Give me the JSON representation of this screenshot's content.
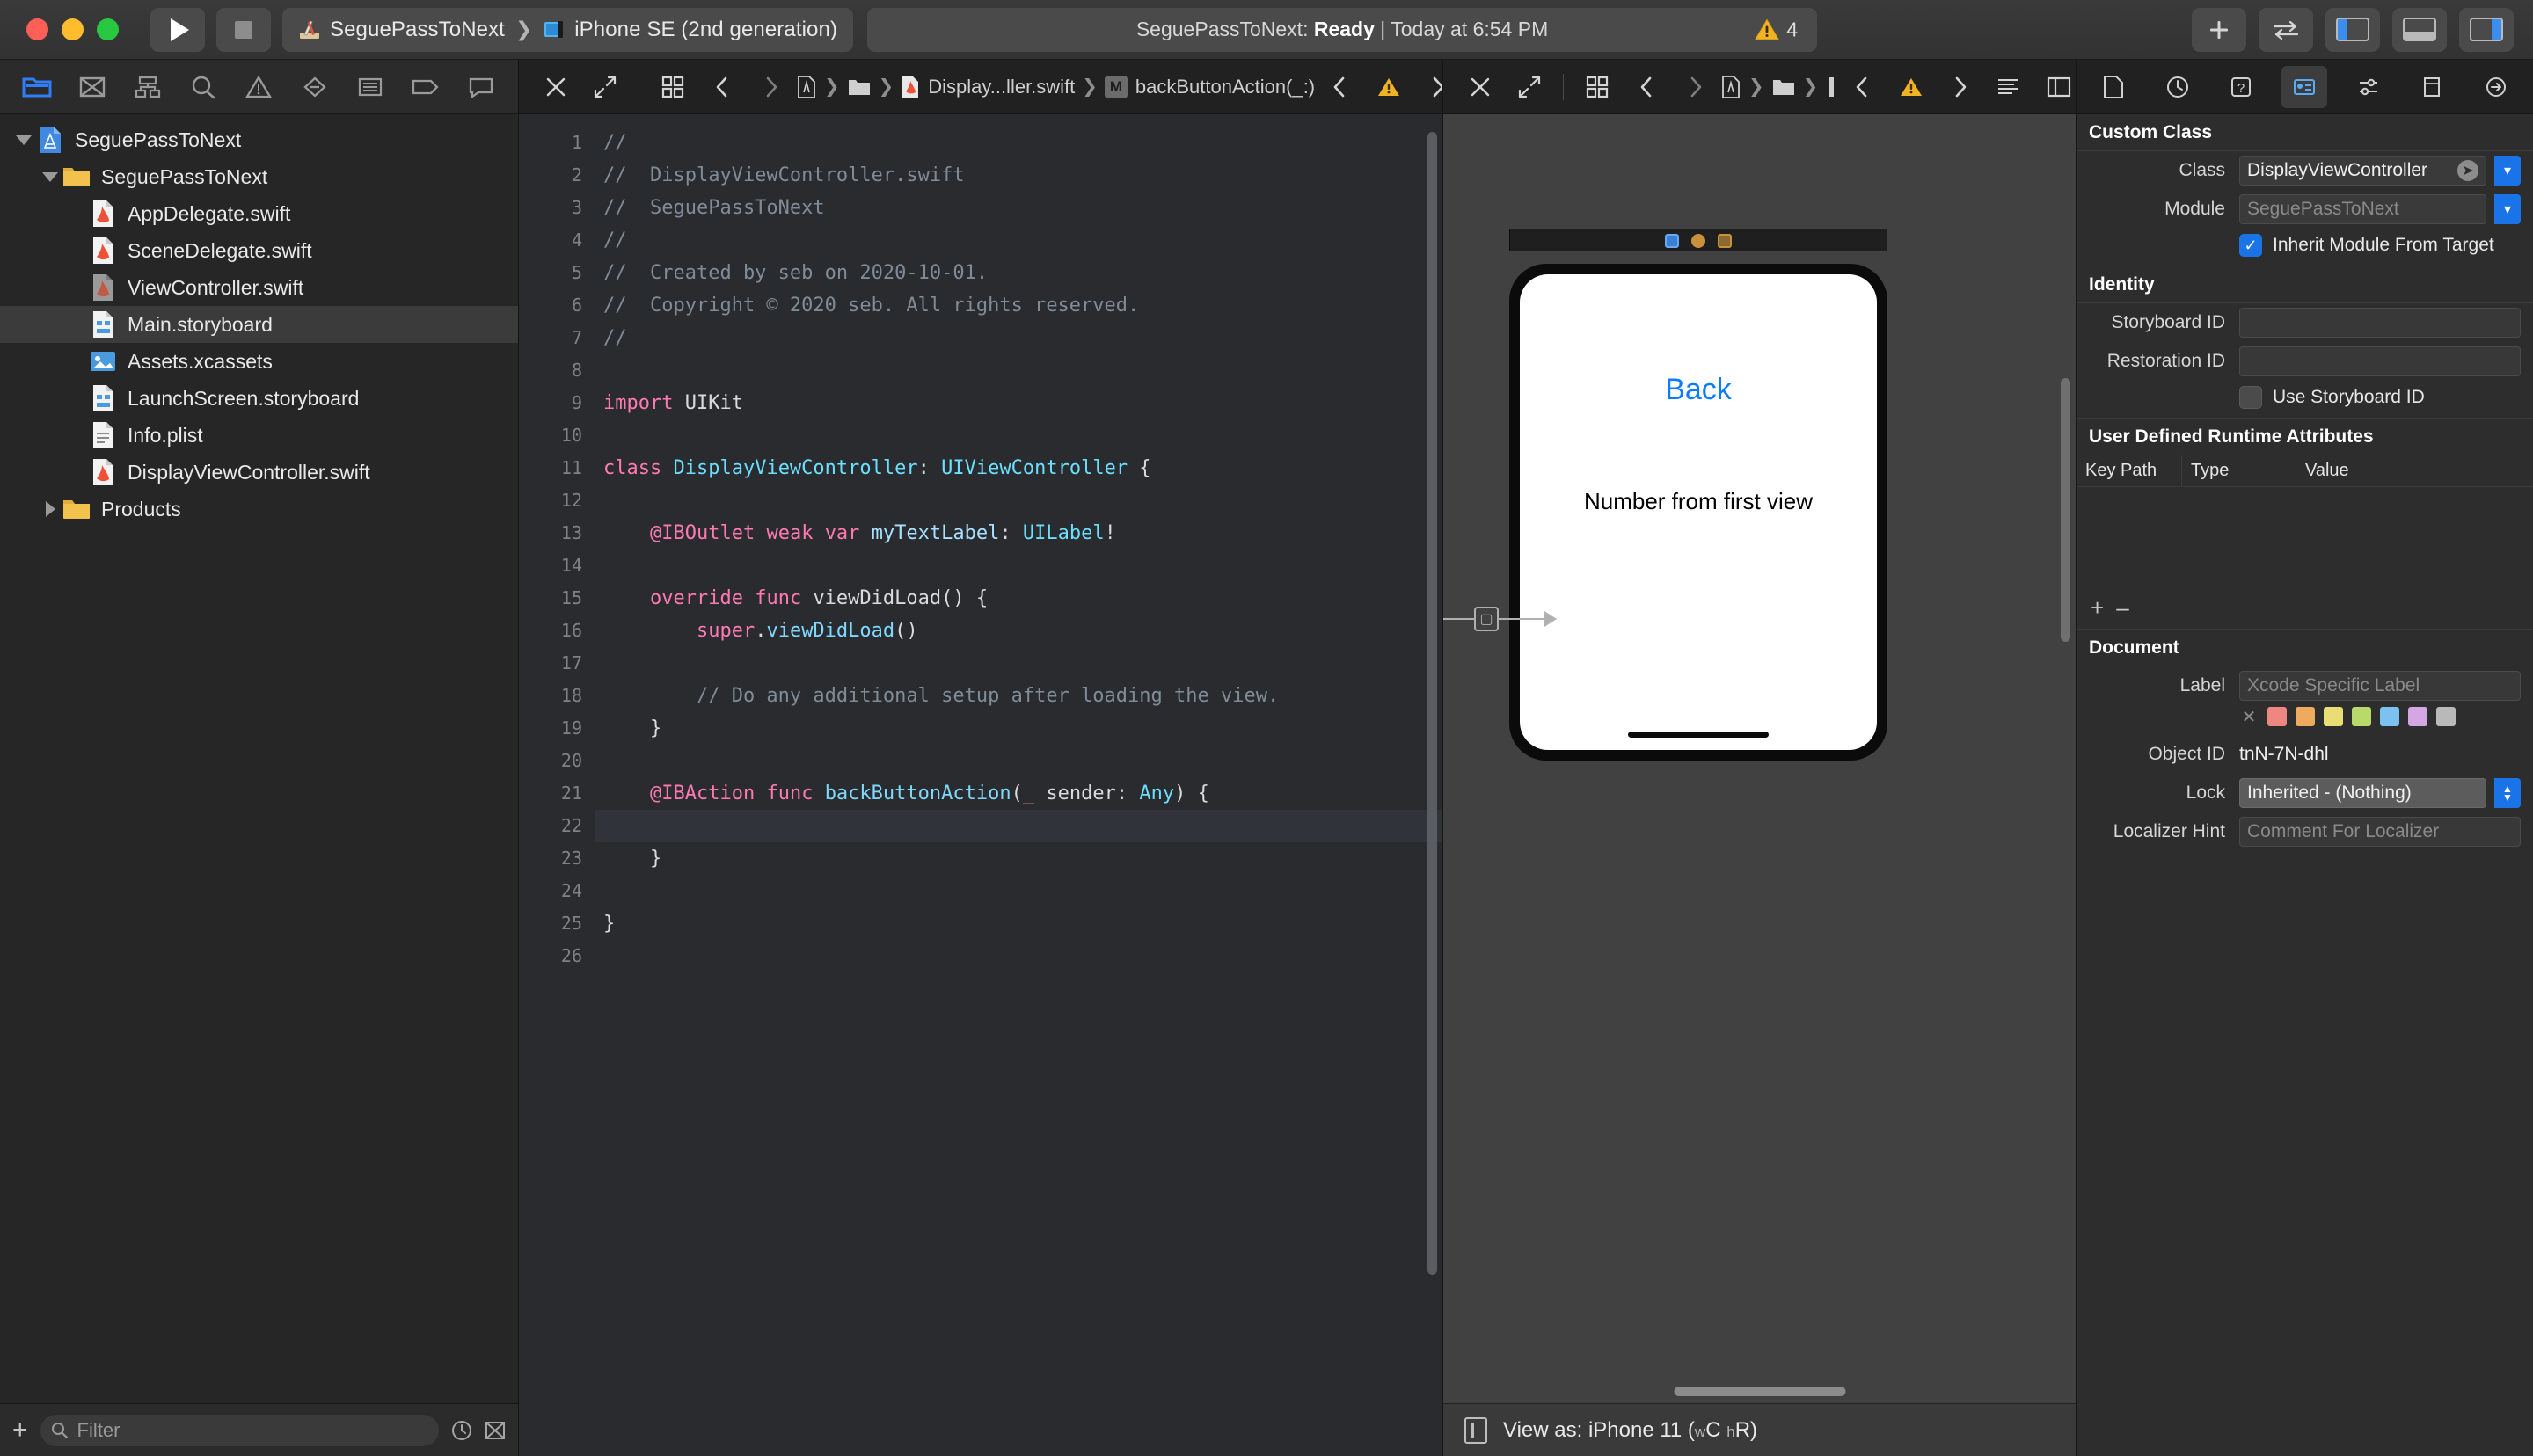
{
  "titlebar": {
    "scheme_project": "SeguePassToNext",
    "scheme_device": "iPhone SE (2nd generation)",
    "status_prefix": "SeguePassToNext: ",
    "status_state": "Ready",
    "status_suffix": " | Today at 6:54 PM",
    "warning_count": "4",
    "add_label": "+",
    "swap_label": "↔"
  },
  "navigator": {
    "toolbar_icons": [
      "folder-icon",
      "source-control-icon",
      "symbol-icon",
      "search-icon",
      "warning-icon",
      "breakpoint-icon",
      "report-icon",
      "tag-icon",
      "comment-icon"
    ],
    "items": [
      {
        "label": "SeguePassToNext",
        "indent": 0,
        "icon": "project-icon",
        "disclosure": "open",
        "selected": false
      },
      {
        "label": "SeguePassToNext",
        "indent": 1,
        "icon": "folder-icon",
        "disclosure": "open",
        "selected": false
      },
      {
        "label": "AppDelegate.swift",
        "indent": 2,
        "icon": "swift-icon",
        "disclosure": "none",
        "selected": false
      },
      {
        "label": "SceneDelegate.swift",
        "indent": 2,
        "icon": "swift-icon",
        "disclosure": "none",
        "selected": false
      },
      {
        "label": "ViewController.swift",
        "indent": 2,
        "icon": "swift-gray-icon",
        "disclosure": "none",
        "selected": false
      },
      {
        "label": "Main.storyboard",
        "indent": 2,
        "icon": "storyboard-icon",
        "disclosure": "none",
        "selected": true
      },
      {
        "label": "Assets.xcassets",
        "indent": 2,
        "icon": "assets-icon",
        "disclosure": "none",
        "selected": false
      },
      {
        "label": "LaunchScreen.storyboard",
        "indent": 2,
        "icon": "storyboard-icon",
        "disclosure": "none",
        "selected": false
      },
      {
        "label": "Info.plist",
        "indent": 2,
        "icon": "plist-icon",
        "disclosure": "none",
        "selected": false
      },
      {
        "label": "DisplayViewController.swift",
        "indent": 2,
        "icon": "swift-icon",
        "disclosure": "none",
        "selected": false
      },
      {
        "label": "Products",
        "indent": 1,
        "icon": "folder-icon",
        "disclosure": "closed",
        "selected": false
      }
    ],
    "filter_placeholder": "Filter",
    "add_button": "+"
  },
  "editor": {
    "breadcrumb_file": "Display...ller.swift",
    "breadcrumb_symbol": "backButtonAction(_:)",
    "symbol_badge": "M",
    "lines": [
      {
        "n": 1,
        "breakpoint": false,
        "current": false,
        "tokens": [
          {
            "t": "//",
            "c": "cmt"
          }
        ]
      },
      {
        "n": 2,
        "breakpoint": false,
        "current": false,
        "tokens": [
          {
            "t": "//  DisplayViewController.swift",
            "c": "cmt"
          }
        ]
      },
      {
        "n": 3,
        "breakpoint": false,
        "current": false,
        "tokens": [
          {
            "t": "//  SeguePassToNext",
            "c": "cmt"
          }
        ]
      },
      {
        "n": 4,
        "breakpoint": false,
        "current": false,
        "tokens": [
          {
            "t": "//",
            "c": "cmt"
          }
        ]
      },
      {
        "n": 5,
        "breakpoint": false,
        "current": false,
        "tokens": [
          {
            "t": "//  Created by seb on 2020-10-01.",
            "c": "cmt"
          }
        ]
      },
      {
        "n": 6,
        "breakpoint": false,
        "current": false,
        "tokens": [
          {
            "t": "//  Copyright © 2020 seb. All rights reserved.",
            "c": "cmt"
          }
        ]
      },
      {
        "n": 7,
        "breakpoint": false,
        "current": false,
        "tokens": [
          {
            "t": "//",
            "c": "cmt"
          }
        ]
      },
      {
        "n": 8,
        "breakpoint": false,
        "current": false,
        "tokens": []
      },
      {
        "n": 9,
        "breakpoint": false,
        "current": false,
        "tokens": [
          {
            "t": "import",
            "c": "kw"
          },
          {
            "t": " UIKit",
            "c": "plain"
          }
        ]
      },
      {
        "n": 10,
        "breakpoint": false,
        "current": false,
        "tokens": []
      },
      {
        "n": 11,
        "breakpoint": false,
        "current": false,
        "tokens": [
          {
            "t": "class",
            "c": "kw"
          },
          {
            "t": " ",
            "c": "plain"
          },
          {
            "t": "DisplayViewController",
            "c": "typ"
          },
          {
            "t": ": ",
            "c": "plain"
          },
          {
            "t": "UIViewController",
            "c": "typ"
          },
          {
            "t": " {",
            "c": "plain"
          }
        ]
      },
      {
        "n": 12,
        "breakpoint": false,
        "current": false,
        "tokens": []
      },
      {
        "n": 13,
        "breakpoint": true,
        "current": false,
        "tokens": [
          {
            "t": "    ",
            "c": "plain"
          },
          {
            "t": "@IBOutlet",
            "c": "attr"
          },
          {
            "t": " ",
            "c": "plain"
          },
          {
            "t": "weak",
            "c": "kw"
          },
          {
            "t": " ",
            "c": "plain"
          },
          {
            "t": "var",
            "c": "kw"
          },
          {
            "t": " ",
            "c": "plain"
          },
          {
            "t": "myTextLabel",
            "c": "varn"
          },
          {
            "t": ": ",
            "c": "plain"
          },
          {
            "t": "UILabel",
            "c": "typ"
          },
          {
            "t": "!",
            "c": "plain"
          }
        ]
      },
      {
        "n": 14,
        "breakpoint": false,
        "current": false,
        "tokens": []
      },
      {
        "n": 15,
        "breakpoint": false,
        "current": false,
        "tokens": [
          {
            "t": "    ",
            "c": "plain"
          },
          {
            "t": "override",
            "c": "kw"
          },
          {
            "t": " ",
            "c": "plain"
          },
          {
            "t": "func",
            "c": "kw"
          },
          {
            "t": " ",
            "c": "plain"
          },
          {
            "t": "viewDidLoad",
            "c": "plain"
          },
          {
            "t": "() {",
            "c": "plain"
          }
        ]
      },
      {
        "n": 16,
        "breakpoint": false,
        "current": false,
        "tokens": [
          {
            "t": "        ",
            "c": "plain"
          },
          {
            "t": "super",
            "c": "kw"
          },
          {
            "t": ".",
            "c": "plain"
          },
          {
            "t": "viewDidLoad",
            "c": "fn"
          },
          {
            "t": "()",
            "c": "plain"
          }
        ]
      },
      {
        "n": 17,
        "breakpoint": false,
        "current": false,
        "tokens": []
      },
      {
        "n": 18,
        "breakpoint": false,
        "current": false,
        "tokens": [
          {
            "t": "        // Do any additional setup after loading the view.",
            "c": "cmt"
          }
        ]
      },
      {
        "n": 19,
        "breakpoint": false,
        "current": false,
        "tokens": [
          {
            "t": "    }",
            "c": "plain"
          }
        ]
      },
      {
        "n": 20,
        "breakpoint": false,
        "current": false,
        "tokens": []
      },
      {
        "n": 21,
        "breakpoint": true,
        "current": false,
        "tokens": [
          {
            "t": "    ",
            "c": "plain"
          },
          {
            "t": "@IBAction",
            "c": "attr"
          },
          {
            "t": " ",
            "c": "plain"
          },
          {
            "t": "func",
            "c": "kw"
          },
          {
            "t": " ",
            "c": "plain"
          },
          {
            "t": "backButtonAction",
            "c": "fn"
          },
          {
            "t": "(",
            "c": "plain"
          },
          {
            "t": "_",
            "c": "kw"
          },
          {
            "t": " sender: ",
            "c": "plain"
          },
          {
            "t": "Any",
            "c": "typ"
          },
          {
            "t": ") {",
            "c": "plain"
          }
        ]
      },
      {
        "n": 22,
        "breakpoint": false,
        "current": true,
        "tokens": []
      },
      {
        "n": 23,
        "breakpoint": false,
        "current": false,
        "tokens": [
          {
            "t": "    }",
            "c": "plain"
          }
        ]
      },
      {
        "n": 24,
        "breakpoint": false,
        "current": false,
        "tokens": []
      },
      {
        "n": 25,
        "breakpoint": false,
        "current": false,
        "tokens": [
          {
            "t": "}",
            "c": "plain"
          }
        ]
      },
      {
        "n": 26,
        "breakpoint": false,
        "current": false,
        "tokens": []
      }
    ]
  },
  "interface_builder": {
    "back_button_label": "Back",
    "number_label": "Number from first view",
    "view_as_label": "View as: iPhone 11 (",
    "view_as_w": "w",
    "view_as_wc": "C",
    "view_as_h": "h",
    "view_as_hr": "R",
    "view_as_close": ")"
  },
  "inspector": {
    "tabs": [
      "file-inspector-icon",
      "history-inspector-icon",
      "quick-help-icon",
      "identity-inspector-icon",
      "attributes-inspector-icon",
      "size-inspector-icon",
      "connections-inspector-icon"
    ],
    "active_tab_index": 3,
    "custom_class": {
      "title": "Custom Class",
      "class_label": "Class",
      "class_value": "DisplayViewController",
      "module_label": "Module",
      "module_value": "SeguePassToNext",
      "inherit_label": "Inherit Module From Target",
      "inherit_checked": true
    },
    "identity": {
      "title": "Identity",
      "storyboard_id_label": "Storyboard ID",
      "storyboard_id_value": "",
      "restoration_id_label": "Restoration ID",
      "restoration_id_value": "",
      "use_storyboard_id_label": "Use Storyboard ID",
      "use_storyboard_id_checked": false
    },
    "runtime_attributes": {
      "title": "User Defined Runtime Attributes",
      "columns": [
        "Key Path",
        "Type",
        "Value"
      ],
      "rows": [],
      "add_label": "+",
      "remove_label": "–"
    },
    "document": {
      "title": "Document",
      "label_label": "Label",
      "label_placeholder": "Xcode Specific Label",
      "swatches": [
        "#ee8782",
        "#eeaa5e",
        "#e9de73",
        "#b9d96b",
        "#7bc2f0",
        "#d4a6e3",
        "#b9b9b9"
      ],
      "object_id_label": "Object ID",
      "object_id_value": "tnN-7N-dhl",
      "lock_label": "Lock",
      "lock_value": "Inherited - (Nothing)",
      "localizer_hint_label": "Localizer Hint",
      "localizer_hint_placeholder": "Comment For Localizer"
    }
  }
}
